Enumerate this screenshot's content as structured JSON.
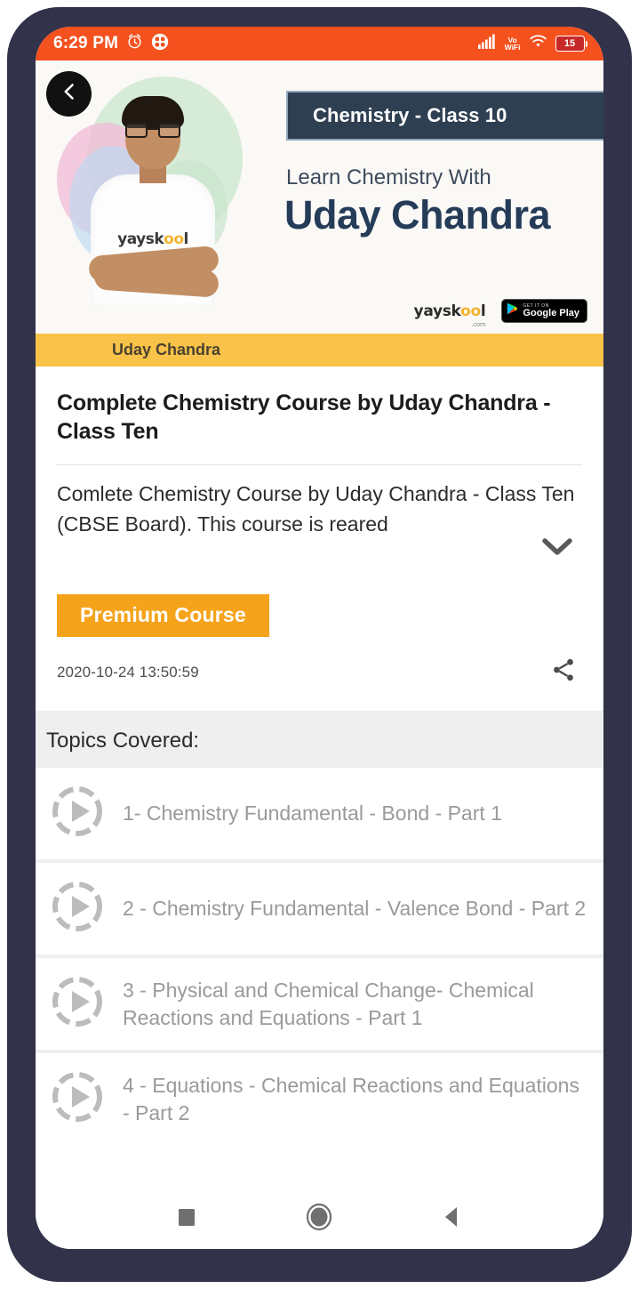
{
  "status_bar": {
    "time": "6:29 PM",
    "alarm_icon": "alarm-clock-icon",
    "apps_icon": "app-grid-icon",
    "signal_icon": "cellular-signal-icon",
    "volte_label_top": "Vo",
    "volte_label_bottom": "WiFi",
    "wifi_icon": "wifi-icon",
    "battery_level": "15",
    "background_color": "#F4511E"
  },
  "back_button": {
    "icon": "chevron-left-icon",
    "label": "Back"
  },
  "hero": {
    "course_tag": "Chemistry - Class 10",
    "tagline": "Learn Chemistry With",
    "instructor_name": "Uday Chandra",
    "brand_mark": "yayskool",
    "brand_mark_accent": "oo",
    "brand_suffix": ".com",
    "play_store_top": "GET IT ON",
    "play_store_bottom": "Google Play",
    "tag_background": "#2E3F52"
  },
  "instructor_strip": {
    "name": "Uday Chandra",
    "background_color": "#F9C349"
  },
  "course": {
    "title": "Complete Chemistry Course by Uday Chandra - Class Ten",
    "description": "Comlete Chemistry Course by Uday Chandra - Class Ten (CBSE Board). This course is reared",
    "expand_icon": "chevron-down-icon",
    "badge_label": "Premium Course",
    "badge_color": "#F5A31B",
    "date": "2020-10-24 13:50:59",
    "share_icon": "share-icon"
  },
  "topics": {
    "heading": "Topics Covered:",
    "items": [
      {
        "label": "1- Chemistry Fundamental - Bond - Part 1",
        "icon": "play-circle-icon"
      },
      {
        "label": "2 - Chemistry Fundamental - Valence Bond - Part 2",
        "icon": "play-circle-icon"
      },
      {
        "label": "3 - Physical and Chemical Change- Chemical Reactions and Equations - Part 1",
        "icon": "play-circle-icon"
      },
      {
        "label": "4 - Equations  - Chemical Reactions and Equations - Part 2",
        "icon": "play-circle-icon"
      }
    ]
  },
  "nav_bar": {
    "recents_icon": "square-recents-icon",
    "home_icon": "circle-home-icon",
    "back_icon": "triangle-back-icon"
  }
}
